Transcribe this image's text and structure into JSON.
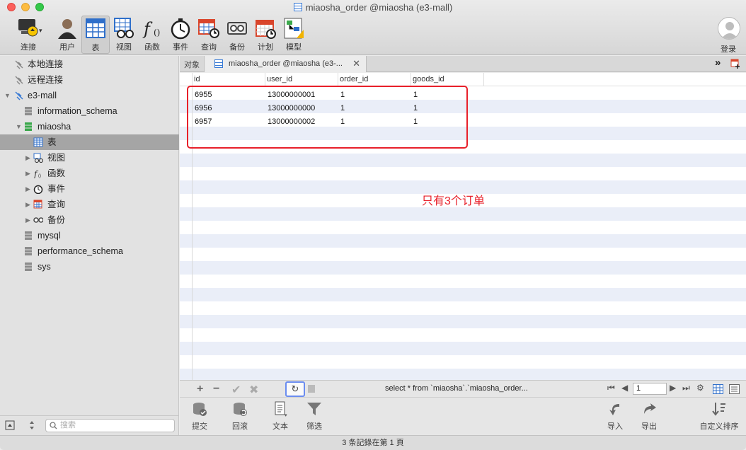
{
  "window": {
    "title": "miaosha_order @miaosha (e3-mall)"
  },
  "toolbar": {
    "connect": "连接",
    "user": "用户",
    "table": "表",
    "view": "视图",
    "function": "函数",
    "event": "事件",
    "query": "查询",
    "backup": "备份",
    "schedule": "计划",
    "model": "模型",
    "login": "登录"
  },
  "sidebar": {
    "items": [
      {
        "label": "本地连接"
      },
      {
        "label": "远程连接"
      },
      {
        "label": "e3-mall"
      },
      {
        "label": "information_schema"
      },
      {
        "label": "miaosha"
      },
      {
        "label": "表"
      },
      {
        "label": "视图"
      },
      {
        "label": "函数"
      },
      {
        "label": "事件"
      },
      {
        "label": "查询"
      },
      {
        "label": "备份"
      },
      {
        "label": "mysql"
      },
      {
        "label": "performance_schema"
      },
      {
        "label": "sys"
      }
    ],
    "search_placeholder": "搜索"
  },
  "tabs": {
    "objects": "对象",
    "active": "miaosha_order @miaosha (e3-...",
    "close": "✕"
  },
  "grid": {
    "columns": [
      "id",
      "user_id",
      "order_id",
      "goods_id"
    ],
    "rows": [
      [
        "6955",
        "13000000001",
        "1",
        "1"
      ],
      [
        "6956",
        "13000000000",
        "1",
        "1"
      ],
      [
        "6957",
        "13000000002",
        "1",
        "1"
      ]
    ]
  },
  "annotation": "只有3个订单",
  "grid_toolbar": {
    "sql": "select * from `miaosha`.`miaosha_order...",
    "page": "1"
  },
  "bottom_toolbar": {
    "commit": "提交",
    "rollback": "回滚",
    "text": "文本",
    "filter": "筛选",
    "import": "导入",
    "export": "导出",
    "custom_sort": "自定义排序"
  },
  "status": "3 条記錄在第 1 頁",
  "colors": {
    "highlight": "#e8202a",
    "accent": "#3a7bd5"
  }
}
